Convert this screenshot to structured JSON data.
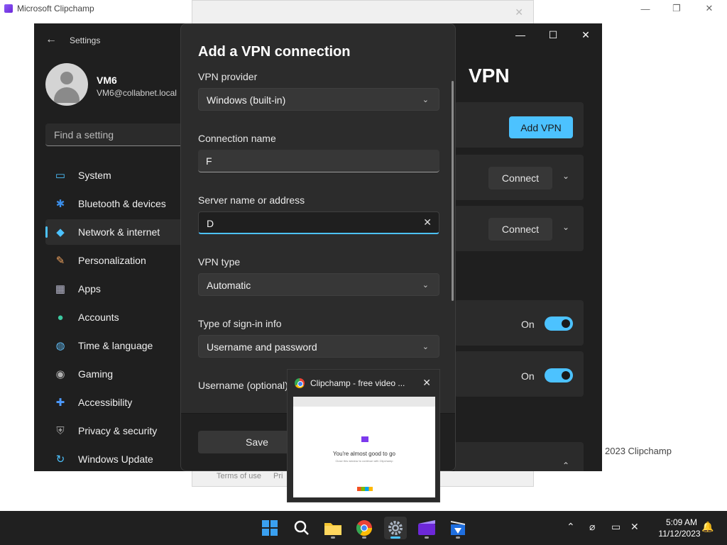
{
  "background_app": {
    "title": "Microsoft Clipchamp",
    "controls": [
      "—",
      "❐",
      "✕"
    ],
    "footer_text": "2023 Clipchamp",
    "dialog_close": "✕",
    "terms_text": "Terms of use",
    "privacy_text": "Pri"
  },
  "settings": {
    "app_title": "Settings",
    "back": "←",
    "controls": [
      "—",
      "☐",
      "✕"
    ],
    "user": {
      "name": "VM6",
      "email": "VM6@collabnet.local"
    },
    "search_placeholder": "Find a setting",
    "nav": [
      {
        "label": "System",
        "icon": "system-icon",
        "glyph": "▭",
        "color": "#4cc2ff"
      },
      {
        "label": "Bluetooth & devices",
        "icon": "bluetooth-icon",
        "glyph": "✱",
        "color": "#3b8eea"
      },
      {
        "label": "Network & internet",
        "icon": "network-icon",
        "glyph": "◆",
        "color": "#4cc2ff"
      },
      {
        "label": "Personalization",
        "icon": "paintbrush-icon",
        "glyph": "✎",
        "color": "#f0a35e"
      },
      {
        "label": "Apps",
        "icon": "apps-icon",
        "glyph": "▦",
        "color": "#b4b4c8"
      },
      {
        "label": "Accounts",
        "icon": "accounts-icon",
        "glyph": "●",
        "color": "#3cc8a0"
      },
      {
        "label": "Time & language",
        "icon": "globe-icon",
        "glyph": "◍",
        "color": "#5fb8f0"
      },
      {
        "label": "Gaming",
        "icon": "gamepad-icon",
        "glyph": "◉",
        "color": "#b0b0b0"
      },
      {
        "label": "Accessibility",
        "icon": "accessibility-icon",
        "glyph": "✚",
        "color": "#4c9aff"
      },
      {
        "label": "Privacy & security",
        "icon": "shield-icon",
        "glyph": "⛨",
        "color": "#9a9a9a"
      },
      {
        "label": "Windows Update",
        "icon": "update-icon",
        "glyph": "↻",
        "color": "#4cc2ff"
      }
    ],
    "active_nav": "Network & internet",
    "page_title": "VPN",
    "add_vpn": "Add VPN",
    "connect_1": "Connect",
    "connect_2": "Connect",
    "chevron": "⌄",
    "chevron_up": "⌃",
    "toggle_1": "On",
    "toggle_2": "On"
  },
  "dialog": {
    "title": "Add a VPN connection",
    "vpn_provider_label": "VPN provider",
    "vpn_provider_value": "Windows (built-in)",
    "connection_name_label": "Connection name",
    "connection_name_value": "F",
    "server_label": "Server name or address",
    "server_value": "D",
    "clear_glyph": "✕",
    "vpn_type_label": "VPN type",
    "vpn_type_value": "Automatic",
    "signin_label": "Type of sign-in info",
    "signin_value": "Username and password",
    "username_label": "Username (optional)",
    "dropdown_chevron": "⌄",
    "save": "Save"
  },
  "preview": {
    "title": "Clipchamp - free video ...",
    "close": "✕",
    "heading": "You're almost good to go",
    "sub": "Close this window to continue with Clipchamp"
  },
  "taskbar": {
    "time": "5:09 AM",
    "date": "11/12/2023",
    "tray_chevron": "⌃",
    "tray_network": "⌀",
    "tray_display": "▭",
    "tray_volume": "✕",
    "tray_bell": "🔔"
  },
  "colors": {
    "accent": "#4cc2ff",
    "settings_bg": "#1f1f1f",
    "dialog_bg": "#2c2c2c",
    "taskbar_bg": "#202020"
  }
}
